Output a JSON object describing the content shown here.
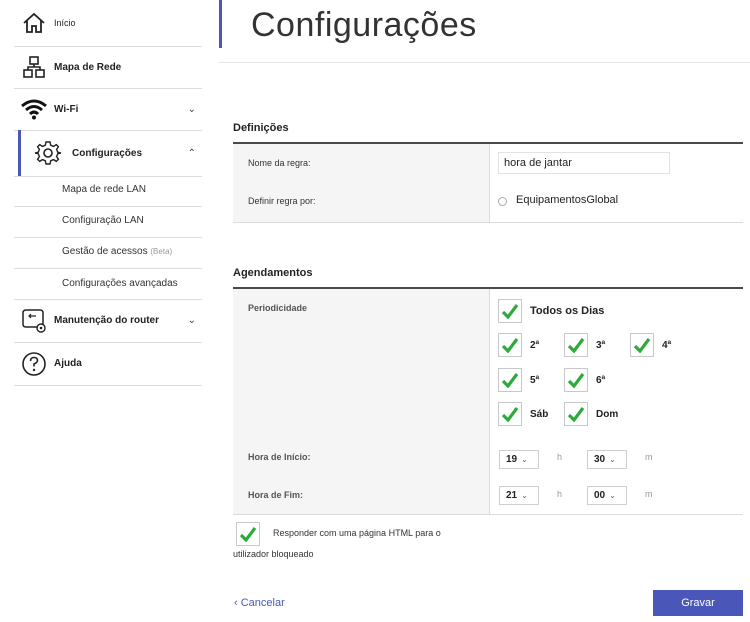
{
  "sidebar": {
    "items": [
      {
        "label": "Início",
        "icon": "home-icon"
      },
      {
        "label": "Mapa de Rede",
        "icon": "network-map-icon"
      },
      {
        "label": "Wi-Fi",
        "icon": "wifi-icon"
      },
      {
        "label": "Configurações",
        "icon": "gear-icon"
      },
      {
        "label": "Manutenção do router",
        "icon": "router-maintenance-icon"
      },
      {
        "label": "Ajuda",
        "icon": "help-icon"
      }
    ],
    "sub_items": [
      {
        "label": "Mapa de rede LAN"
      },
      {
        "label": "Configuração LAN"
      },
      {
        "label": "Gestão de acessos",
        "badge": "(Beta)"
      },
      {
        "label": "Configurações avançadas"
      }
    ]
  },
  "page": {
    "title": "Configurações"
  },
  "definitions": {
    "title": "Definições",
    "rule_name_label": "Nome da regra:",
    "rule_name_value": "hora de jantar",
    "define_by_label": "Definir regra por:",
    "define_by_options": "EquipamentosGlobal"
  },
  "schedule": {
    "title": "Agendamentos",
    "periodicity_label": "Periodicidade",
    "all_days": "Todos os Dias",
    "days": [
      "2ª",
      "3ª",
      "4ª",
      "5ª",
      "6ª",
      "Sáb",
      "Dom"
    ],
    "start_label": "Hora de Início:",
    "start_hour": "19",
    "start_min": "30",
    "end_label": "Hora de Fim:",
    "end_hour": "21",
    "end_min": "00",
    "unit_h": "h",
    "unit_m": "m"
  },
  "respond": {
    "line1": "Responder com uma página HTML para o",
    "line2": "utilizador bloqueado"
  },
  "actions": {
    "cancel": "‹ Cancelar",
    "save": "Gravar"
  },
  "colors": {
    "accent": "#4a57b8",
    "check": "#2eaa3c"
  }
}
